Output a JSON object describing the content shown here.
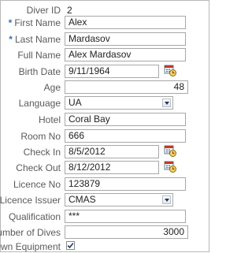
{
  "form": {
    "diver_id": {
      "label": "Diver ID",
      "value": "2"
    },
    "first_name": {
      "label": "First Name",
      "value": "Alex",
      "required_mark": "*"
    },
    "last_name": {
      "label": "Last Name",
      "value": "Mardasov",
      "required_mark": "*"
    },
    "full_name": {
      "label": "Full Name",
      "value": "Alex Mardasov"
    },
    "birth_date": {
      "label": "Birth Date",
      "value": "9/11/1964"
    },
    "age": {
      "label": "Age",
      "value": "48"
    },
    "language": {
      "label": "Language",
      "value": "UA"
    },
    "hotel": {
      "label": "Hotel",
      "value": "Coral Bay"
    },
    "room_no": {
      "label": "Room No",
      "value": "666"
    },
    "check_in": {
      "label": "Check In",
      "value": "8/5/2012"
    },
    "check_out": {
      "label": "Check Out",
      "value": "8/12/2012"
    },
    "licence_no": {
      "label": "Licence No",
      "value": "123879"
    },
    "licence_issuer": {
      "label": "Licence Issuer",
      "value": "CMAS"
    },
    "qualification": {
      "label": "Qualification",
      "value": "***"
    },
    "number_of_dives": {
      "label": "Number of Dives",
      "value": "3000"
    },
    "own_equipment": {
      "label": "Own Equipment",
      "checked": true
    }
  },
  "icons": {
    "calendar": "calendar-icon",
    "dropdown": "chevron-down-icon",
    "check": "checkmark-icon"
  },
  "colors": {
    "required_asterisk": "#3a6fb0",
    "label_text": "#5a5a5a",
    "field_border": "#a8a8a8"
  }
}
